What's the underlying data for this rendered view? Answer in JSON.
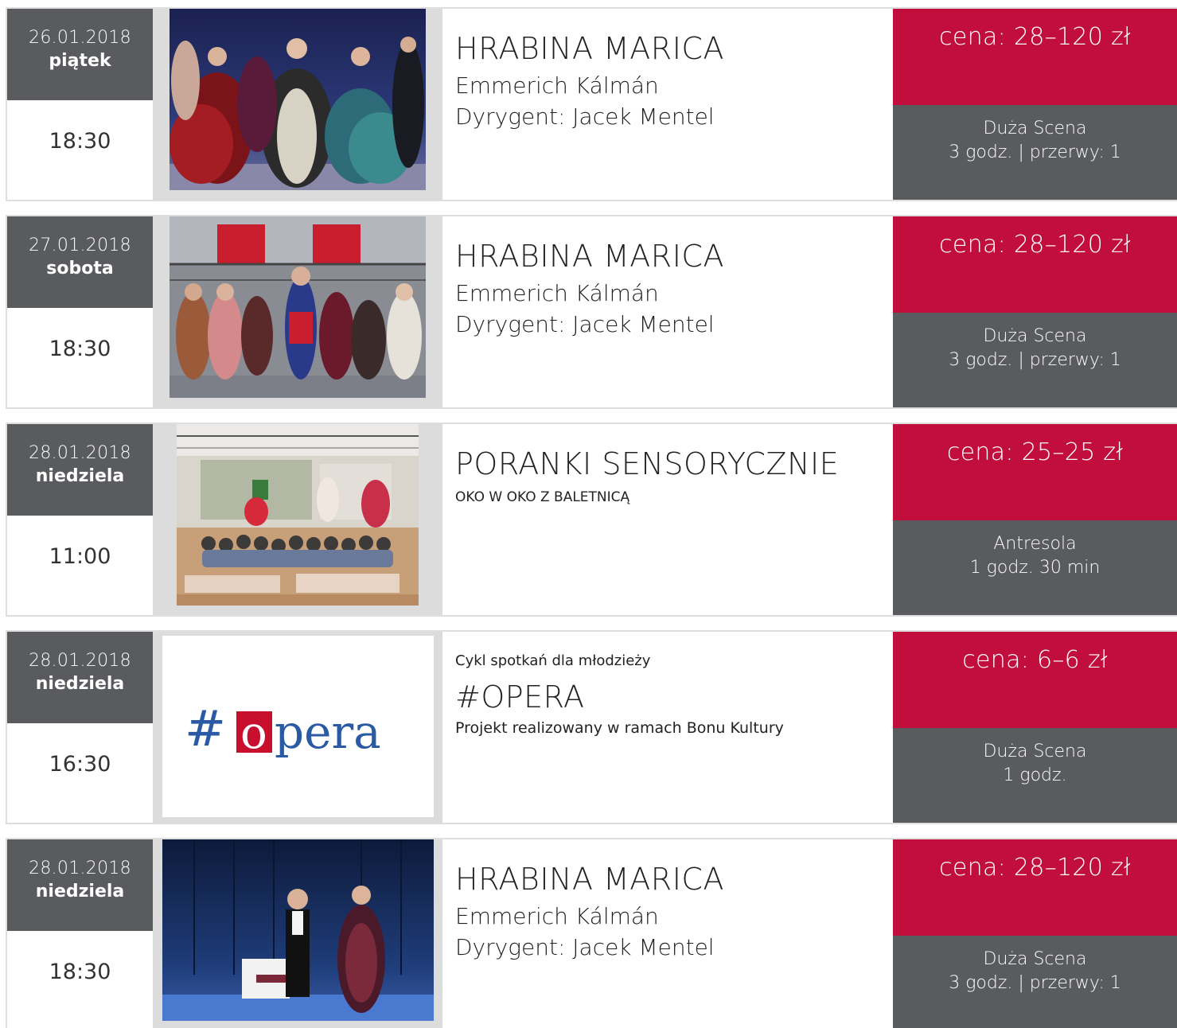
{
  "events": [
    {
      "date": "26.01.2018",
      "weekday": "piątek",
      "time": "18:30",
      "title": "HRABINA MARICA",
      "line1": "Emmerich Kálmán",
      "line2": "Dyrygent: Jacek Mentel",
      "price": "cena: 28–120 zł",
      "venue": "Duża Scena",
      "duration": "3 godz. | przerwy: 1",
      "image": "opera-stage-photo-dancers"
    },
    {
      "date": "27.01.2018",
      "weekday": "sobota",
      "time": "18:30",
      "title": "HRABINA MARICA",
      "line1": "Emmerich Kálmán",
      "line2": "Dyrygent: Jacek Mentel",
      "price": "cena: 28–120 zł",
      "venue": "Duża Scena",
      "duration": "3 godz. | przerwy: 1",
      "image": "opera-stage-photo-chorus"
    },
    {
      "date": "28.01.2018",
      "weekday": "niedziela",
      "time": "11:00",
      "title": "PORANKI SENSORYCZNIE",
      "subtitle": "OKO W OKO Z BALETNICĄ",
      "price": "cena: 25–25 zł",
      "venue": "Antresola",
      "duration": "1 godz. 30 min",
      "image": "children-workshop-photo"
    },
    {
      "date": "28.01.2018",
      "weekday": "niedziela",
      "time": "16:30",
      "pretitle": "Cykl spotkań dla młodzieży",
      "title": "#OPERA",
      "subtitle": "Projekt realizowany w ramach Bonu Kultury",
      "price": "cena: 6–6 zł",
      "venue": "Duża Scena",
      "duration": "1 godz.",
      "logo": {
        "hash": "#",
        "o": "o",
        "rest": "pera",
        "blue": "#2a5aa3",
        "red": "#c8102e"
      }
    },
    {
      "date": "28.01.2018",
      "weekday": "niedziela",
      "time": "18:30",
      "title": "HRABINA MARICA",
      "line1": "Emmerich Kálmán",
      "line2": "Dyrygent: Jacek Mentel",
      "price": "cena: 28–120 zł",
      "venue": "Duża Scena",
      "duration": "3 godz. | przerwy: 1",
      "image": "opera-duet-photo"
    }
  ],
  "colors": {
    "price_bg": "#c20e3c",
    "gray_bg": "#5a5b5e",
    "border": "#dedede",
    "image_bg": "#dcdcdc"
  }
}
